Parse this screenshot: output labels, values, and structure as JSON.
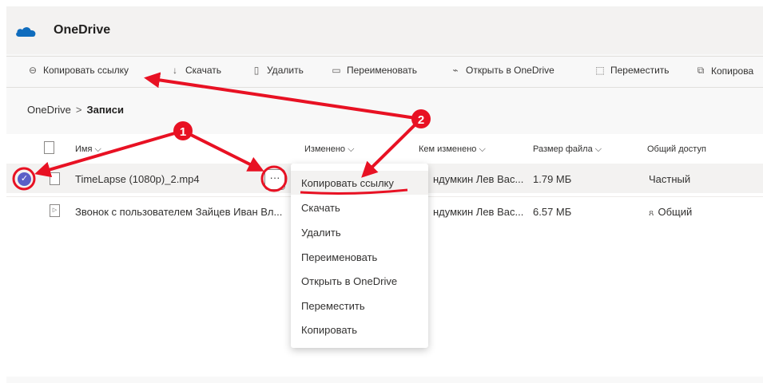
{
  "header": {
    "app_title": "OneDrive",
    "logo_icon": "onedrive-cloud-icon",
    "brand_color": "#0f6cbd"
  },
  "toolbar": {
    "items": [
      {
        "label": "Копировать ссылку",
        "icon": "link-icon"
      },
      {
        "label": "Скачать",
        "icon": "download-icon"
      },
      {
        "label": "Удалить",
        "icon": "trash-icon"
      },
      {
        "label": "Переименовать",
        "icon": "rename-icon"
      },
      {
        "label": "Открыть в OneDrive",
        "icon": "open-icon"
      },
      {
        "label": "Переместить",
        "icon": "move-icon"
      },
      {
        "label": "Копирова",
        "icon": "copy-icon"
      }
    ]
  },
  "breadcrumb": {
    "root": "OneDrive",
    "separator": ">",
    "current": "Записи"
  },
  "list": {
    "columns": [
      "Имя",
      "Изменено",
      "Кем изменено",
      "Размер файла",
      "Общий доступ"
    ],
    "rows": [
      {
        "name": "TimeLapse (1080p)_2.mp4",
        "modified_by": "ндумкин Лев Вас...",
        "size": "1.79 МБ",
        "sharing": "Частный",
        "selected": true
      },
      {
        "name": "Звонок с пользователем Зайцев Иван Вл...",
        "modified_by": "ндумкин Лев Вас...",
        "size": "6.57 МБ",
        "sharing": "Общий",
        "selected": false
      }
    ]
  },
  "context_menu": {
    "items": [
      "Копировать ссылку",
      "Скачать",
      "Удалить",
      "Переименовать",
      "Открыть в OneDrive",
      "Переместить",
      "Копировать"
    ]
  },
  "annotations": {
    "markers": [
      "1",
      "2"
    ],
    "color": "#e81123"
  },
  "more_button": {
    "glyph": "···"
  }
}
